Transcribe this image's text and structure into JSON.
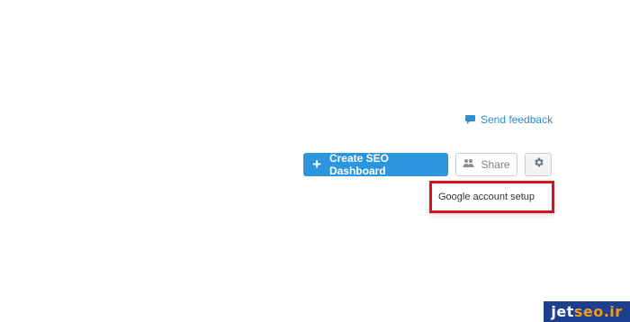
{
  "feedback": {
    "label": "Send feedback",
    "icon": "speech-bubble-icon"
  },
  "toolbar": {
    "create_label": "Create SEO Dashboard",
    "create_icon": "plus-icon",
    "share_label": "Share",
    "share_icon": "users-icon",
    "settings_icon": "gear-icon"
  },
  "dropdown": {
    "items": [
      {
        "label": "Google account setup"
      }
    ]
  },
  "watermark": {
    "part1": "jet",
    "part2": "seo.ir"
  },
  "colors": {
    "accent": "#2b95dd",
    "link": "#2a8fd3",
    "highlight_border": "#d7131f",
    "watermark_bg": "#1d3f8f",
    "watermark_accent": "#f39a1c"
  }
}
